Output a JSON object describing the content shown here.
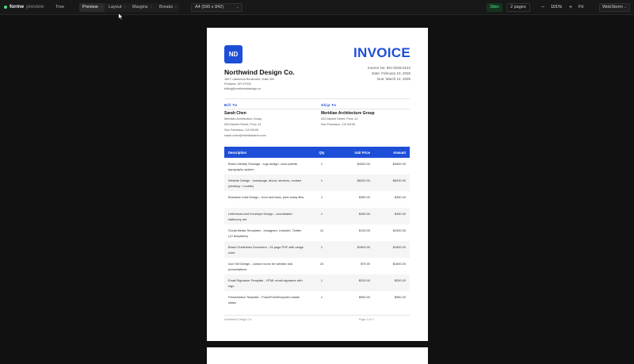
{
  "toolbar": {
    "brand": "forme",
    "brand_sub": "preview",
    "tree_label": "Tree",
    "tabs": [
      {
        "label": "Preview",
        "active": true
      },
      {
        "label": "Layout",
        "active": false
      },
      {
        "label": "Margins",
        "active": false
      },
      {
        "label": "Breaks",
        "active": false
      }
    ],
    "page_size": "A4 (595 x 842)",
    "render_time": "38ms",
    "page_count": "2 pages",
    "zoom_out": "−",
    "zoom_level": "101%",
    "zoom_in": "+",
    "fit": "Fit",
    "editor": "WebStorm",
    "accent_color": "#4ade80"
  },
  "invoice": {
    "logo_initials": "ND",
    "company_name": "Northwind Design Co.",
    "company_address_1": "1847 Lakewood Boulevard, Suite 300",
    "company_address_2": "Portland, OR 97205",
    "company_email": "billing@northwinddesign.co",
    "title": "INVOICE",
    "invoice_no": "Invoice No: INV-2026-0142",
    "date": "Date: February 10, 2026",
    "due": "Due: March 12, 2026",
    "bill_to": {
      "heading": "Bill To",
      "name": "Sarah Chen",
      "company": "Meridian Architecture Group",
      "street": "520 Market Street, Floor 14",
      "city": "San Francisco, CA 94105",
      "email": "sarah.chen@meridianarch.com"
    },
    "ship_to": {
      "heading": "Ship To",
      "name": "Meridian Architecture Group",
      "street": "520 Market Street, Floor 14",
      "city": "San Francisco, CA 94105"
    },
    "table_headers": {
      "description": "Description",
      "qty": "Qty",
      "unit_price": "Unit Price",
      "amount": "Amount"
    },
    "items": [
      {
        "description": "Brand Identity Package - logo design, color palette, typography system",
        "qty": "1",
        "unit_price": "$4500.00",
        "amount": "$4500.00"
      },
      {
        "description": "Website Design - homepage, about, services, contact (desktop + mobile)",
        "qty": "1",
        "unit_price": "$6200.00",
        "amount": "$6200.00"
      },
      {
        "description": "Business Card Design - front and back, print-ready files",
        "qty": "1",
        "unit_price": "$350.00",
        "amount": "$350.00"
      },
      {
        "description": "Letterhead and Envelope Design - coordinated stationery set",
        "qty": "1",
        "unit_price": "$450.00",
        "amount": "$450.00"
      },
      {
        "description": "Social Media Templates - Instagram, LinkedIn, Twitter (12 templates)",
        "qty": "12",
        "unit_price": "$125.00",
        "amount": "$1500.00"
      },
      {
        "description": "Brand Guidelines Document - 24-page PDF with usage rules",
        "qty": "1",
        "unit_price": "$1800.00",
        "amount": "$1800.00"
      },
      {
        "description": "Icon Set Design - custom icons for website and presentations",
        "qty": "24",
        "unit_price": "$75.00",
        "amount": "$1800.00"
      },
      {
        "description": "Email Signature Template - HTML email signature with logo",
        "qty": "1",
        "unit_price": "$200.00",
        "amount": "$200.00"
      },
      {
        "description": "Presentation Template - PowerPoint/Keynote master slides",
        "qty": "1",
        "unit_price": "$950.00",
        "amount": "$950.00"
      }
    ],
    "footer_company": "Northwind Design Co.",
    "footer_page": "Page 1 of 2",
    "accent_color": "#1d4ed8"
  }
}
